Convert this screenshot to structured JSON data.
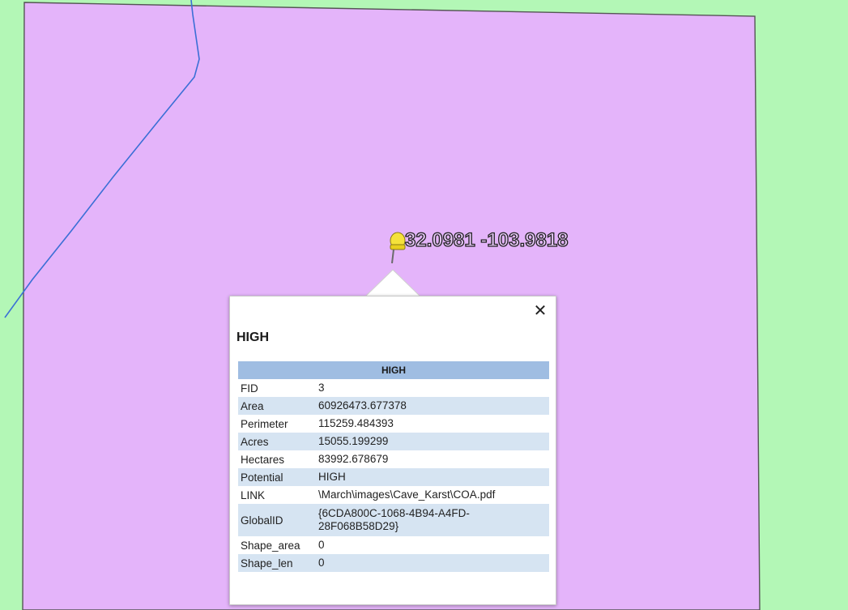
{
  "map": {
    "coordinate_label": "32.0981 -103.9818",
    "background_color": "#b3f7b6",
    "polygon_fill_color": "#e4b4fa",
    "polygon_border_color": "#555555",
    "line_color": "#3b6fd6"
  },
  "popup": {
    "title": "HIGH",
    "close_icon": "close-icon",
    "table": {
      "header": "HIGH",
      "rows": [
        {
          "key": "FID",
          "value": "3"
        },
        {
          "key": "Area",
          "value": "60926473.677378"
        },
        {
          "key": "Perimeter",
          "value": "115259.484393"
        },
        {
          "key": "Acres",
          "value": "15055.199299"
        },
        {
          "key": "Hectares",
          "value": "83992.678679"
        },
        {
          "key": "Potential",
          "value": "HIGH"
        },
        {
          "key": "LINK",
          "value": "\\March\\images\\Cave_Karst\\COA.pdf"
        },
        {
          "key": "GlobalID",
          "value": "{6CDA800C-1068-4B94-A4FD-28F068B58D29}"
        },
        {
          "key": "Shape_area",
          "value": "0"
        },
        {
          "key": "Shape_len",
          "value": "0"
        }
      ]
    }
  }
}
